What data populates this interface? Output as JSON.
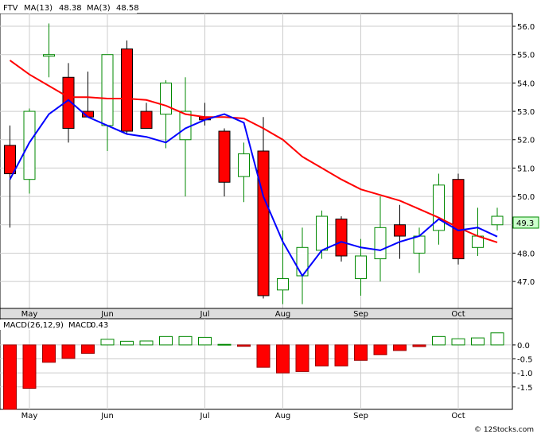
{
  "chart_data": [
    {
      "type": "candlestick",
      "ticker": "FTV",
      "legend": [
        {
          "label": "FTV",
          "color": "#000000"
        },
        {
          "label": "MA(13)",
          "value": "48.38",
          "color": "#ff0000"
        },
        {
          "label": "MA(3)",
          "value": "48.58",
          "color": "#0000ff"
        }
      ],
      "last_price_label": "49.3",
      "y_ticks": [
        "56.0",
        "55.0",
        "54.0",
        "53.0",
        "52.0",
        "51.0",
        "50.0",
        "49.0",
        "48.0",
        "47.0"
      ],
      "ylim": [
        46.05,
        56.45
      ],
      "x_labels": [
        "May",
        "Jun",
        "Jul",
        "Aug",
        "Sep",
        "Oct"
      ],
      "x_label_index": [
        1,
        5,
        10,
        14,
        18,
        23
      ],
      "candles": [
        {
          "o": 51.8,
          "h": 52.5,
          "l": 48.9,
          "c": 50.8
        },
        {
          "o": 50.6,
          "h": 53.1,
          "l": 50.1,
          "c": 53.0
        },
        {
          "o": 55.0,
          "h": 56.1,
          "l": 54.2,
          "c": 55.0
        },
        {
          "o": 54.2,
          "h": 54.7,
          "l": 51.9,
          "c": 52.4
        },
        {
          "o": 53.0,
          "h": 54.4,
          "l": 52.8,
          "c": 52.8
        },
        {
          "o": 52.5,
          "h": 55.0,
          "l": 51.6,
          "c": 55.0
        },
        {
          "o": 55.2,
          "h": 55.5,
          "l": 52.2,
          "c": 52.3
        },
        {
          "o": 53.0,
          "h": 53.3,
          "l": 52.5,
          "c": 52.4
        },
        {
          "o": 52.9,
          "h": 54.1,
          "l": 51.7,
          "c": 54.0
        },
        {
          "o": 52.0,
          "h": 54.2,
          "l": 50.0,
          "c": 53.0
        },
        {
          "o": 52.8,
          "h": 53.3,
          "l": 52.5,
          "c": 52.7
        },
        {
          "o": 52.3,
          "h": 52.4,
          "l": 50.0,
          "c": 50.5
        },
        {
          "o": 50.7,
          "h": 51.9,
          "l": 49.8,
          "c": 51.5
        },
        {
          "o": 51.6,
          "h": 52.8,
          "l": 46.4,
          "c": 46.5
        },
        {
          "o": 46.7,
          "h": 48.8,
          "l": 46.2,
          "c": 47.1
        },
        {
          "o": 47.2,
          "h": 48.9,
          "l": 46.2,
          "c": 48.2
        },
        {
          "o": 48.1,
          "h": 49.5,
          "l": 47.8,
          "c": 49.3
        },
        {
          "o": 49.2,
          "h": 49.3,
          "l": 47.7,
          "c": 47.9
        },
        {
          "o": 47.1,
          "h": 48.5,
          "l": 46.5,
          "c": 47.9
        },
        {
          "o": 47.8,
          "h": 50.0,
          "l": 47.0,
          "c": 48.9
        },
        {
          "o": 49.0,
          "h": 49.7,
          "l": 47.8,
          "c": 48.6
        },
        {
          "o": 48.0,
          "h": 48.9,
          "l": 47.3,
          "c": 48.6
        },
        {
          "o": 48.8,
          "h": 50.8,
          "l": 48.3,
          "c": 50.4
        },
        {
          "o": 50.6,
          "h": 50.8,
          "l": 47.6,
          "c": 47.8
        },
        {
          "o": 48.2,
          "h": 49.6,
          "l": 47.9,
          "c": 48.6
        },
        {
          "o": 49.0,
          "h": 49.6,
          "l": 48.8,
          "c": 49.3
        }
      ],
      "ma13": [
        [
          0,
          54.8
        ],
        [
          1,
          54.3
        ],
        [
          2,
          53.9
        ],
        [
          3,
          53.5
        ],
        [
          4,
          53.5
        ],
        [
          5,
          53.45
        ],
        [
          6,
          53.45
        ],
        [
          7,
          53.4
        ],
        [
          8,
          53.2
        ],
        [
          9,
          52.9
        ],
        [
          10,
          52.8
        ],
        [
          11,
          52.8
        ],
        [
          12,
          52.75
        ],
        [
          13,
          52.4
        ],
        [
          14,
          52.0
        ],
        [
          15,
          51.4
        ],
        [
          16,
          51.0
        ],
        [
          17,
          50.6
        ],
        [
          18,
          50.25
        ],
        [
          19,
          50.05
        ],
        [
          20,
          49.85
        ],
        [
          21,
          49.55
        ],
        [
          22,
          49.25
        ],
        [
          23,
          48.9
        ],
        [
          24,
          48.6
        ],
        [
          25,
          48.38
        ]
      ],
      "ma3": [
        [
          0,
          50.6
        ],
        [
          1,
          51.9
        ],
        [
          2,
          52.9
        ],
        [
          3,
          53.4
        ],
        [
          4,
          52.8
        ],
        [
          5,
          52.5
        ],
        [
          6,
          52.2
        ],
        [
          7,
          52.1
        ],
        [
          8,
          51.9
        ],
        [
          9,
          52.4
        ],
        [
          10,
          52.7
        ],
        [
          11,
          52.9
        ],
        [
          12,
          52.6
        ],
        [
          13,
          50.0
        ],
        [
          14,
          48.4
        ],
        [
          15,
          47.2
        ],
        [
          16,
          48.1
        ],
        [
          17,
          48.4
        ],
        [
          18,
          48.2
        ],
        [
          19,
          48.1
        ],
        [
          20,
          48.4
        ],
        [
          21,
          48.6
        ],
        [
          22,
          49.2
        ],
        [
          23,
          48.8
        ],
        [
          24,
          48.9
        ],
        [
          25,
          48.58
        ]
      ]
    },
    {
      "type": "bar",
      "title": "MACD(26,12,9)",
      "legend_label": "MACD",
      "legend_value": "0.43",
      "y_ticks": [
        "0.0",
        "-0.5",
        "-1.0",
        "-1.5"
      ],
      "ylim": [
        -2.3,
        0.48
      ],
      "values": [
        -2.3,
        -1.55,
        -0.62,
        -0.48,
        -0.3,
        0.2,
        0.13,
        0.14,
        0.3,
        0.3,
        0.27,
        0.02,
        -0.05,
        -0.8,
        -1.0,
        -0.95,
        -0.75,
        -0.75,
        -0.55,
        -0.35,
        -0.2,
        -0.06,
        0.3,
        0.22,
        0.25,
        0.43
      ]
    }
  ],
  "watermark": "© 12Stocks.com",
  "colors": {
    "up_stroke": "#008800",
    "down_fill": "#ff0000",
    "ma13": "#ff0000",
    "ma3": "#0000ff",
    "grid": "#cccccc",
    "macd_pos": "#008800",
    "macd_neg": "#ff0000"
  }
}
